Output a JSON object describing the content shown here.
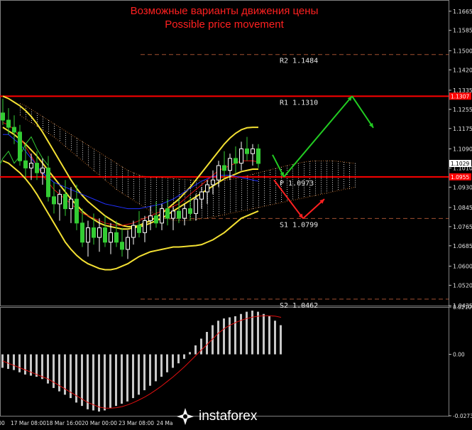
{
  "titles": {
    "ru": "Возможные варианты движения цены",
    "en": "Possible price movement"
  },
  "watermark": {
    "text": "instaforex"
  },
  "colors": {
    "background": "#000000",
    "bull_candle": "#ffffff",
    "bear_candle": "#33cc33",
    "bollinger": "#f3e033",
    "kijun": "#2030ff",
    "tenkan": "#e01010",
    "chikou": "#33cc33",
    "level_line": "#ff0000",
    "dashed_level": "#a05030",
    "arrow_up": "#22cc22",
    "arrow_down": "#ff2020",
    "cloud": "#ffffff",
    "macd_hist": "#c8c8c8",
    "macd_signal": "#e01010",
    "grid": "#606060"
  },
  "chart_data": [
    {
      "type": "candlestick",
      "ylim": [
        1.0435,
        1.17
      ],
      "y_ticks": [
        "1.1665",
        "1.1585",
        "1.1500",
        "1.1420",
        "1.1335",
        "1.1255",
        "1.1175",
        "1.1090",
        "1.1010",
        "1.0930",
        "1.0845",
        "1.0765",
        "1.0685",
        "1.0600",
        "1.0520",
        "1.0435"
      ],
      "x_ticks": [
        "00",
        "17 Mar 08:00",
        "18 Mar 16:00",
        "20 Mar 00:00",
        "23 Mar 08:00",
        "24 Ma"
      ],
      "current_price": "1.1029",
      "levels": [
        {
          "name": "R2",
          "value": 1.1484,
          "label": "R2  1.1484",
          "style": "dashed"
        },
        {
          "name": "R1",
          "value": 1.131,
          "label": "R1  1.1310",
          "style": "solid",
          "tag": "1.1307"
        },
        {
          "name": "P",
          "value": 1.0973,
          "label": "P  1.0973",
          "style": "solid",
          "tag": "1.0955"
        },
        {
          "name": "S1",
          "value": 1.0799,
          "label": "S1  1.0799",
          "style": "dashed"
        },
        {
          "name": "S2",
          "value": 1.0462,
          "label": "S2  1.0462",
          "style": "dashed"
        }
      ],
      "candles": [
        {
          "o": 1.124,
          "h": 1.13,
          "l": 1.119,
          "c": 1.121
        },
        {
          "o": 1.121,
          "h": 1.126,
          "l": 1.115,
          "c": 1.118
        },
        {
          "o": 1.118,
          "h": 1.123,
          "l": 1.111,
          "c": 1.116
        },
        {
          "o": 1.116,
          "h": 1.119,
          "l": 1.102,
          "c": 1.104
        },
        {
          "o": 1.104,
          "h": 1.111,
          "l": 1.097,
          "c": 1.101
        },
        {
          "o": 1.101,
          "h": 1.107,
          "l": 1.096,
          "c": 1.103
        },
        {
          "o": 1.103,
          "h": 1.108,
          "l": 1.096,
          "c": 1.099
        },
        {
          "o": 1.099,
          "h": 1.105,
          "l": 1.094,
          "c": 1.101
        },
        {
          "o": 1.101,
          "h": 1.106,
          "l": 1.087,
          "c": 1.089
        },
        {
          "o": 1.089,
          "h": 1.095,
          "l": 1.082,
          "c": 1.086
        },
        {
          "o": 1.086,
          "h": 1.092,
          "l": 1.079,
          "c": 1.09
        },
        {
          "o": 1.09,
          "h": 1.096,
          "l": 1.081,
          "c": 1.084
        },
        {
          "o": 1.084,
          "h": 1.093,
          "l": 1.078,
          "c": 1.088
        },
        {
          "o": 1.088,
          "h": 1.094,
          "l": 1.075,
          "c": 1.078
        },
        {
          "o": 1.078,
          "h": 1.084,
          "l": 1.068,
          "c": 1.07
        },
        {
          "o": 1.07,
          "h": 1.079,
          "l": 1.064,
          "c": 1.076
        },
        {
          "o": 1.076,
          "h": 1.082,
          "l": 1.069,
          "c": 1.072
        },
        {
          "o": 1.072,
          "h": 1.08,
          "l": 1.066,
          "c": 1.076
        },
        {
          "o": 1.076,
          "h": 1.081,
          "l": 1.068,
          "c": 1.07
        },
        {
          "o": 1.07,
          "h": 1.078,
          "l": 1.065,
          "c": 1.074
        },
        {
          "o": 1.074,
          "h": 1.079,
          "l": 1.068,
          "c": 1.07
        },
        {
          "o": 1.07,
          "h": 1.076,
          "l": 1.064,
          "c": 1.067
        },
        {
          "o": 1.067,
          "h": 1.075,
          "l": 1.063,
          "c": 1.072
        },
        {
          "o": 1.072,
          "h": 1.079,
          "l": 1.069,
          "c": 1.077
        },
        {
          "o": 1.077,
          "h": 1.083,
          "l": 1.072,
          "c": 1.074
        },
        {
          "o": 1.074,
          "h": 1.081,
          "l": 1.07,
          "c": 1.079
        },
        {
          "o": 1.079,
          "h": 1.085,
          "l": 1.075,
          "c": 1.081
        },
        {
          "o": 1.081,
          "h": 1.087,
          "l": 1.076,
          "c": 1.078
        },
        {
          "o": 1.078,
          "h": 1.086,
          "l": 1.075,
          "c": 1.084
        },
        {
          "o": 1.084,
          "h": 1.088,
          "l": 1.077,
          "c": 1.08
        },
        {
          "o": 1.08,
          "h": 1.085,
          "l": 1.075,
          "c": 1.083
        },
        {
          "o": 1.083,
          "h": 1.088,
          "l": 1.078,
          "c": 1.08
        },
        {
          "o": 1.08,
          "h": 1.086,
          "l": 1.077,
          "c": 1.084
        },
        {
          "o": 1.084,
          "h": 1.089,
          "l": 1.079,
          "c": 1.082
        },
        {
          "o": 1.082,
          "h": 1.09,
          "l": 1.079,
          "c": 1.088
        },
        {
          "o": 1.088,
          "h": 1.093,
          "l": 1.084,
          "c": 1.091
        },
        {
          "o": 1.091,
          "h": 1.096,
          "l": 1.086,
          "c": 1.094
        },
        {
          "o": 1.094,
          "h": 1.1,
          "l": 1.09,
          "c": 1.096
        },
        {
          "o": 1.096,
          "h": 1.104,
          "l": 1.093,
          "c": 1.102
        },
        {
          "o": 1.102,
          "h": 1.108,
          "l": 1.097,
          "c": 1.1
        },
        {
          "o": 1.1,
          "h": 1.107,
          "l": 1.096,
          "c": 1.105
        },
        {
          "o": 1.105,
          "h": 1.11,
          "l": 1.099,
          "c": 1.103
        },
        {
          "o": 1.103,
          "h": 1.112,
          "l": 1.1,
          "c": 1.109
        },
        {
          "o": 1.109,
          "h": 1.114,
          "l": 1.104,
          "c": 1.107
        },
        {
          "o": 1.107,
          "h": 1.111,
          "l": 1.102,
          "c": 1.109
        },
        {
          "o": 1.109,
          "h": 1.111,
          "l": 1.101,
          "c": 1.1029
        }
      ],
      "bollinger_upper": [
        1.131,
        1.13,
        1.1285,
        1.127,
        1.125,
        1.1225,
        1.1195,
        1.116,
        1.112,
        1.108,
        1.104,
        1.1,
        1.096,
        1.0925,
        1.0895,
        1.087,
        1.085,
        1.083,
        1.081,
        1.0795,
        1.078,
        1.077,
        1.0765,
        1.0765,
        1.077,
        1.078,
        1.079,
        1.0805,
        1.082,
        1.084,
        1.086,
        1.088,
        1.0905,
        1.093,
        1.096,
        1.099,
        1.102,
        1.105,
        1.108,
        1.111,
        1.1135,
        1.1155,
        1.117,
        1.1178,
        1.118,
        1.118
      ],
      "bollinger_middle": [
        1.118,
        1.1165,
        1.115,
        1.113,
        1.111,
        1.1085,
        1.106,
        1.103,
        1.1,
        1.097,
        1.094,
        1.091,
        1.088,
        1.0855,
        1.083,
        1.081,
        1.0795,
        1.078,
        1.077,
        1.0765,
        1.076,
        1.0755,
        1.0755,
        1.076,
        1.0765,
        1.077,
        1.078,
        1.079,
        1.08,
        1.0815,
        1.083,
        1.0845,
        1.086,
        1.0875,
        1.089,
        1.0905,
        1.092,
        1.0935,
        1.095,
        1.0965,
        1.0975,
        1.0985,
        1.0995,
        1.1,
        1.1005,
        1.1005
      ],
      "bollinger_lower": [
        1.104,
        1.103,
        1.101,
        1.099,
        1.0965,
        1.0935,
        1.09,
        1.086,
        1.082,
        1.078,
        1.074,
        1.07,
        1.067,
        1.0645,
        1.0625,
        1.061,
        1.06,
        1.059,
        1.0585,
        1.0585,
        1.059,
        1.06,
        1.061,
        1.0625,
        1.064,
        1.065,
        1.066,
        1.0665,
        1.067,
        1.0675,
        1.068,
        1.068,
        1.0682,
        1.0684,
        1.0686,
        1.069,
        1.07,
        1.071,
        1.0725,
        1.074,
        1.076,
        1.078,
        1.08,
        1.081,
        1.082,
        1.083
      ],
      "kijun": [
        1.115,
        1.115,
        1.113,
        1.111,
        1.108,
        1.105,
        1.102,
        1.099,
        1.097,
        1.095,
        1.094,
        1.093,
        1.092,
        1.091,
        1.09,
        1.089,
        1.088,
        1.087,
        1.086,
        1.0855,
        1.085,
        1.0845,
        1.084,
        1.084,
        1.084,
        1.0845,
        1.085,
        1.0855,
        1.086,
        1.087,
        1.088,
        1.0895,
        1.091,
        1.0925,
        1.094,
        1.0955,
        1.0965,
        1.0975,
        1.098,
        1.098,
        1.098,
        1.0975,
        1.097,
        1.0965,
        1.096,
        1.0955
      ],
      "tenkan": [
        1.12,
        1.119,
        1.117,
        1.114,
        1.11,
        1.106,
        1.102,
        1.098,
        1.095,
        1.092,
        1.09,
        1.088,
        1.086,
        1.084,
        1.082,
        1.081,
        1.08,
        1.079,
        1.078,
        1.0775,
        1.077,
        1.077,
        1.0775,
        1.078,
        1.079,
        1.08,
        1.081,
        1.082,
        1.083,
        1.084,
        1.085,
        1.086,
        1.088,
        1.09,
        1.092,
        1.094,
        1.096,
        1.098,
        1.1,
        1.101,
        1.102,
        1.103,
        1.104,
        1.104,
        1.104,
        1.1035
      ],
      "chikou": [
        1.078,
        1.082,
        1.09,
        1.086,
        1.095,
        1.088,
        1.091,
        1.084,
        1.088,
        1.076,
        1.072,
        1.076,
        1.08,
        1.074,
        1.078,
        1.082,
        1.085,
        1.09,
        1.096,
        1.1,
        1.105,
        1.108,
        1.103,
        1.106,
        1.111,
        1.114,
        1.109,
        1.105,
        1.102
      ],
      "cloud_top": [
        1.128,
        1.127,
        1.1255,
        1.124,
        1.1225,
        1.121,
        1.1195,
        1.118,
        1.1165,
        1.115,
        1.1135,
        1.112,
        1.1105,
        1.109,
        1.1075,
        1.106,
        1.1045,
        1.103,
        1.1015,
        1.1,
        1.099,
        1.098,
        1.0975,
        1.097,
        1.097,
        1.097,
        1.0968,
        1.0966,
        1.0964,
        1.0962,
        1.096,
        1.0958,
        1.0957,
        1.0956,
        1.0955,
        1.0955,
        1.0958,
        1.0962,
        1.0966,
        1.0972,
        1.0978,
        1.0984,
        1.099,
        1.0996,
        1.1002,
        1.1008,
        1.1014,
        1.102,
        1.1025,
        1.103,
        1.1035,
        1.1038,
        1.104,
        1.104,
        1.104,
        1.104,
        1.1038,
        1.1035,
        1.1032,
        1.103
      ],
      "cloud_bottom": [
        1.123,
        1.1215,
        1.12,
        1.1185,
        1.117,
        1.1155,
        1.114,
        1.112,
        1.11,
        1.108,
        1.106,
        1.104,
        1.102,
        1.1,
        1.098,
        1.096,
        1.094,
        1.092,
        1.0905,
        1.089,
        1.0875,
        1.086,
        1.0845,
        1.083,
        1.0815,
        1.0805,
        1.0798,
        1.0792,
        1.079,
        1.079,
        1.0792,
        1.0795,
        1.0798,
        1.08,
        1.0805,
        1.081,
        1.0815,
        1.082,
        1.0825,
        1.083,
        1.0835,
        1.084,
        1.0845,
        1.085,
        1.0855,
        1.086,
        1.0865,
        1.087,
        1.0875,
        1.088,
        1.0885,
        1.089,
        1.0895,
        1.09,
        1.0905,
        1.091,
        1.0915,
        1.092,
        1.0925,
        1.093
      ],
      "forecast_up": [
        [
          1.1065,
          1.0973
        ],
        [
          1.131,
          1.1178
        ]
      ],
      "forecast_down": [
        [
          1.096,
          1.0799,
          1.088
        ]
      ]
    },
    {
      "type": "bar",
      "name": "MACD",
      "ylim": [
        -0.02739,
        0.02109
      ],
      "y_ticks": [
        "0.02109",
        "0.00",
        "-0.02739"
      ],
      "histogram": [
        -0.006,
        -0.0065,
        -0.007,
        -0.008,
        -0.009,
        -0.0095,
        -0.01,
        -0.011,
        -0.013,
        -0.015,
        -0.0165,
        -0.018,
        -0.0195,
        -0.0215,
        -0.023,
        -0.0245,
        -0.025,
        -0.0255,
        -0.025,
        -0.024,
        -0.023,
        -0.022,
        -0.021,
        -0.0195,
        -0.018,
        -0.016,
        -0.014,
        -0.012,
        -0.01,
        -0.008,
        -0.006,
        -0.004,
        -0.002,
        0.001,
        0.004,
        0.007,
        0.01,
        0.013,
        0.015,
        0.016,
        0.0165,
        0.017,
        0.018,
        0.019,
        0.0195,
        0.019,
        0.018,
        0.017,
        0.015,
        0.013
      ],
      "signal": [
        -0.003,
        -0.004,
        -0.005,
        -0.006,
        -0.007,
        -0.008,
        -0.009,
        -0.01,
        -0.011,
        -0.0125,
        -0.014,
        -0.0155,
        -0.017,
        -0.0185,
        -0.02,
        -0.0215,
        -0.0225,
        -0.0235,
        -0.024,
        -0.024,
        -0.0238,
        -0.0233,
        -0.0225,
        -0.0215,
        -0.0203,
        -0.019,
        -0.0175,
        -0.0158,
        -0.014,
        -0.012,
        -0.01,
        -0.0078,
        -0.0055,
        -0.003,
        -0.0005,
        0.002,
        0.0045,
        0.007,
        0.0095,
        0.0115,
        0.013,
        0.0142,
        0.0152,
        0.016,
        0.0166,
        0.017,
        0.0172,
        0.0172,
        0.017,
        0.0165
      ]
    }
  ]
}
